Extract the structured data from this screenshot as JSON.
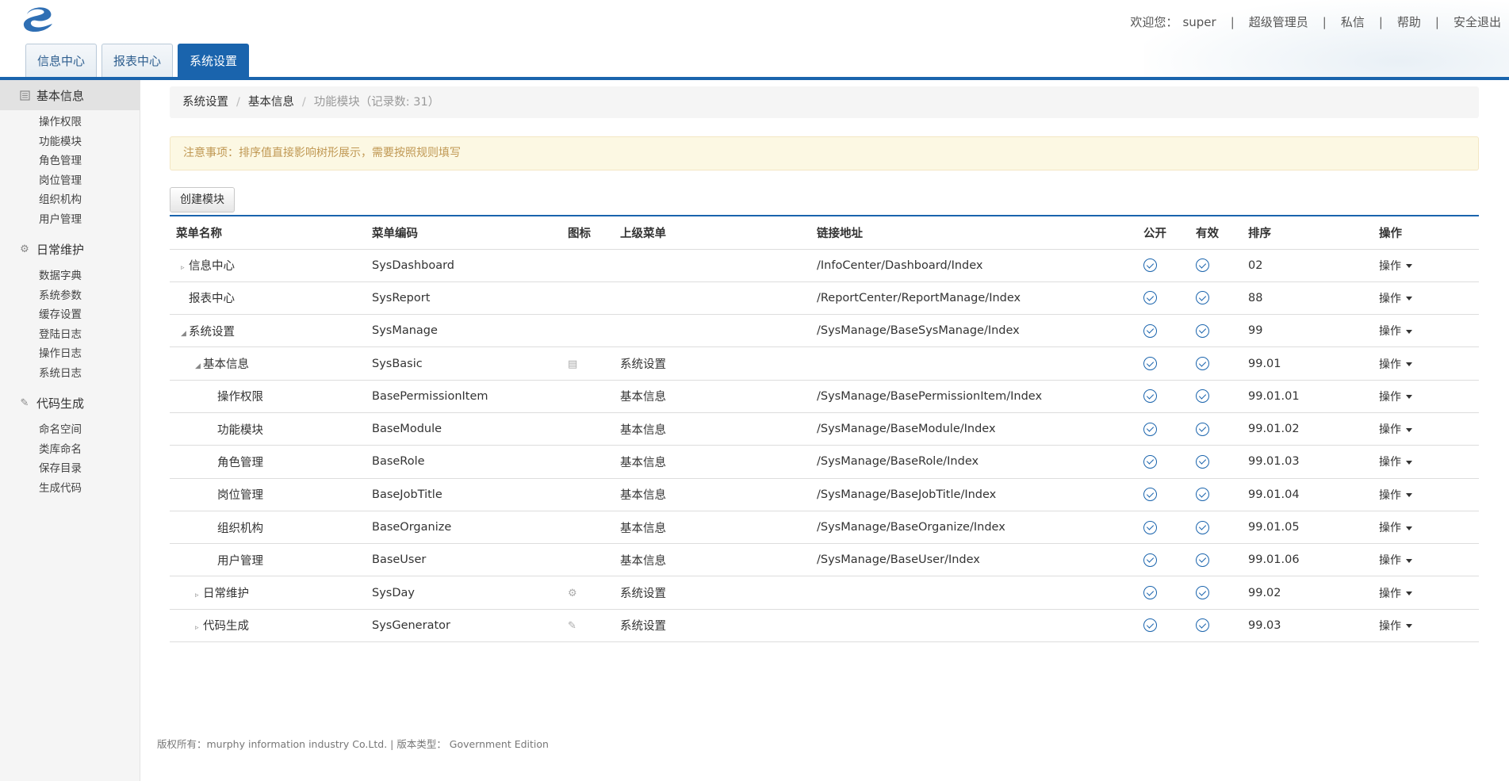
{
  "header": {
    "welcome_label": "欢迎您：",
    "username": "super",
    "role": "超级管理员",
    "messages": "私信",
    "help": "帮助",
    "logout": "安全退出",
    "tabs": [
      "信息中心",
      "报表中心",
      "系统设置"
    ],
    "active_tab": "系统设置"
  },
  "sidebar": {
    "groups": [
      {
        "label": "基本信息",
        "icon": "list-icon",
        "items": [
          "操作权限",
          "功能模块",
          "角色管理",
          "岗位管理",
          "组织机构",
          "用户管理"
        ]
      },
      {
        "label": "日常维护",
        "icon": "gear-icon",
        "items": [
          "数据字典",
          "系统参数",
          "缓存设置",
          "登陆日志",
          "操作日志",
          "系统日志"
        ]
      },
      {
        "label": "代码生成",
        "icon": "pencil-icon",
        "items": [
          "命名空间",
          "类库命名",
          "保存目录",
          "生成代码"
        ]
      }
    ]
  },
  "breadcrumb": {
    "level1": "系统设置",
    "level2": "基本信息",
    "current": "功能模块（记录数: 31）"
  },
  "alert": {
    "text": "注意事项：排序值直接影响树形展示，需要按照规则填写"
  },
  "toolbar": {
    "create_label": "创建模块"
  },
  "table": {
    "headers": [
      "菜单名称",
      "菜单编码",
      "图标",
      "上级菜单",
      "链接地址",
      "公开",
      "有效",
      "排序",
      "操作"
    ],
    "action_label": "操作",
    "rows": [
      {
        "name": "信息中心",
        "code": "SysDashboard",
        "icon": "",
        "parent": "",
        "url": "/InfoCenter/Dashboard/Index",
        "sort": "02"
      },
      {
        "name": "报表中心",
        "code": "SysReport",
        "icon": "",
        "parent": "",
        "url": "/ReportCenter/ReportManage/Index",
        "sort": "88"
      },
      {
        "name": "系统设置",
        "code": "SysManage",
        "icon": "",
        "parent": "",
        "url": "/SysManage/BaseSysManage/Index",
        "sort": "99"
      },
      {
        "name": "基本信息",
        "code": "SysBasic",
        "icon": "list-icon",
        "parent": "系统设置",
        "url": "",
        "sort": "99.01"
      },
      {
        "name": "操作权限",
        "code": "BasePermissionItem",
        "icon": "",
        "parent": "基本信息",
        "url": "/SysManage/BasePermissionItem/Index",
        "sort": "99.01.01"
      },
      {
        "name": "功能模块",
        "code": "BaseModule",
        "icon": "",
        "parent": "基本信息",
        "url": "/SysManage/BaseModule/Index",
        "sort": "99.01.02"
      },
      {
        "name": "角色管理",
        "code": "BaseRole",
        "icon": "",
        "parent": "基本信息",
        "url": "/SysManage/BaseRole/Index",
        "sort": "99.01.03"
      },
      {
        "name": "岗位管理",
        "code": "BaseJobTitle",
        "icon": "",
        "parent": "基本信息",
        "url": "/SysManage/BaseJobTitle/Index",
        "sort": "99.01.04"
      },
      {
        "name": "组织机构",
        "code": "BaseOrganize",
        "icon": "",
        "parent": "基本信息",
        "url": "/SysManage/BaseOrganize/Index",
        "sort": "99.01.05"
      },
      {
        "name": "用户管理",
        "code": "BaseUser",
        "icon": "",
        "parent": "基本信息",
        "url": "/SysManage/BaseUser/Index",
        "sort": "99.01.06"
      },
      {
        "name": "日常维护",
        "code": "SysDay",
        "icon": "gear-icon",
        "parent": "系统设置",
        "url": "",
        "sort": "99.02"
      },
      {
        "name": "代码生成",
        "code": "SysGenerator",
        "icon": "pencil-icon",
        "parent": "系统设置",
        "url": "",
        "sort": "99.03"
      }
    ]
  },
  "footer": {
    "text": "版权所有：murphy information industry Co.Ltd. | 版本类型： Government Edition"
  }
}
